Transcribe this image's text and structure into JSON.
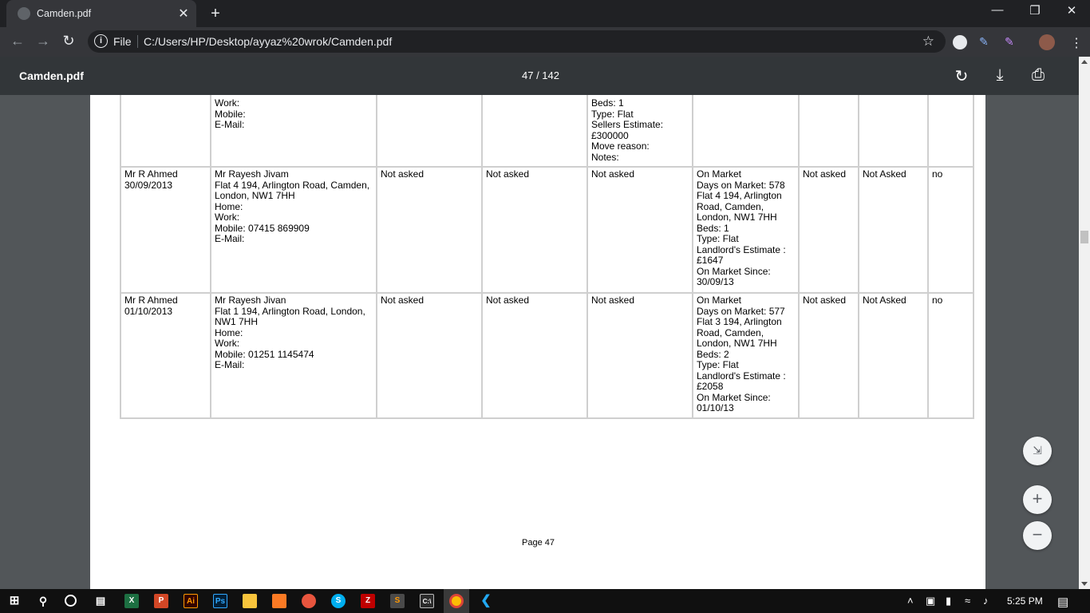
{
  "browser": {
    "tab_title": "Camden.pdf",
    "tab_close": "✕",
    "new_tab": "+",
    "omnibox_scheme": "File",
    "url": "C:/Users/HP/Desktop/ayyaz%20wrok/Camden.pdf"
  },
  "pdf": {
    "title": "Camden.pdf",
    "page_counter": "47 / 142",
    "footer_page": "Page 47"
  },
  "table": {
    "rows": [
      {
        "c1": [],
        "c2": [
          "Work:",
          "Mobile:",
          "E-Mail:"
        ],
        "c3": [],
        "c4": [],
        "c5": [
          "Beds: 1",
          "Type: Flat",
          "Sellers Estimate:",
          "£300000",
          "Move reason:",
          "Notes:"
        ],
        "c6": [],
        "c7": [],
        "c8": [],
        "c9": []
      },
      {
        "c1": [
          "Mr R Ahmed",
          "30/09/2013"
        ],
        "c2": [
          "Mr Rayesh Jivam",
          "Flat 4 194, Arlington Road, Camden,",
          "London, NW1 7HH",
          "Home:",
          "Work:",
          "Mobile: 07415 869909",
          "E-Mail:"
        ],
        "c3": [
          "Not asked"
        ],
        "c4": [
          "Not asked"
        ],
        "c5": [
          "Not asked"
        ],
        "c6": [
          "On Market",
          "Days on Market: 578",
          "Flat 4 194, Arlington",
          "Road, Camden,",
          "London, NW1 7HH",
          "Beds: 1",
          "Type: Flat",
          "Landlord's Estimate :",
          "£1647",
          "On Market Since:",
          "30/09/13"
        ],
        "c7": [
          "Not asked"
        ],
        "c8": [
          "Not Asked"
        ],
        "c9": [
          "no"
        ]
      },
      {
        "c1": [
          "Mr R Ahmed",
          "01/10/2013"
        ],
        "c2": [
          "Mr Rayesh Jivan",
          "Flat 1 194, Arlington Road, London,",
          "NW1 7HH",
          "Home:",
          "Work:",
          "Mobile: 01251 1145474",
          "E-Mail:"
        ],
        "c3": [
          "Not asked"
        ],
        "c4": [
          "Not asked"
        ],
        "c5": [
          "Not asked"
        ],
        "c6": [
          "On Market",
          "Days on Market: 577",
          "Flat 3 194, Arlington",
          "Road, Camden,",
          "London, NW1 7HH",
          "Beds: 2",
          "Type: Flat",
          "Landlord's Estimate :",
          "£2058",
          "On Market Since:",
          "01/10/13"
        ],
        "c7": [
          "Not asked"
        ],
        "c8": [
          "Not Asked"
        ],
        "c9": [
          "no"
        ]
      }
    ]
  },
  "taskbar": {
    "clock": "5:25 PM",
    "apps": [
      "start-icon",
      "search-icon",
      "cortana-icon",
      "task-view-icon",
      "excel-icon",
      "powerpoint-icon",
      "illustrator-icon",
      "photoshop-icon",
      "file-explorer-icon",
      "xampp-icon",
      "app-icon",
      "skype-icon",
      "filezilla-icon",
      "sublime-icon",
      "cmd-icon",
      "chrome-icon",
      "vscode-icon"
    ]
  }
}
